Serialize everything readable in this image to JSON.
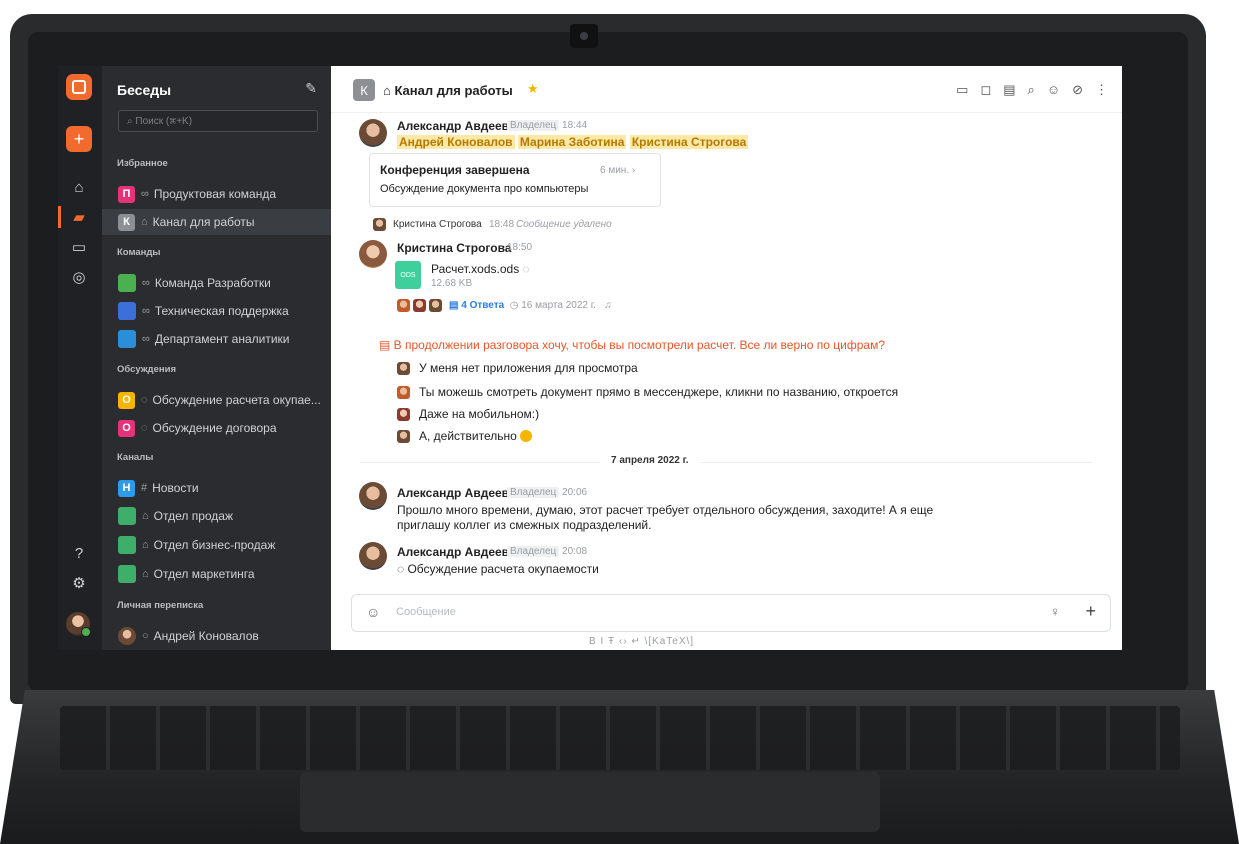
{
  "sidebar": {
    "title": "Беседы",
    "search_placeholder": "Поиск (⌘+K)",
    "sections": {
      "favorites": "Избранное",
      "teams": "Команды",
      "discussions": "Обсуждения",
      "channels": "Каналы",
      "personal": "Личная переписка"
    },
    "items": [
      {
        "letter": "П",
        "label": "Продуктовая команда",
        "color": "#e5337a"
      },
      {
        "letter": "К",
        "label": "Канал для работы",
        "color": "#8c8f94"
      },
      {
        "label": "Команда Разработки"
      },
      {
        "label": "Техническая поддержка"
      },
      {
        "label": "Департамент аналитики"
      },
      {
        "letter": "О",
        "label": "Обсуждение расчета окупае...",
        "color": "#f5b400"
      },
      {
        "letter": "О",
        "label": "Обсуждение договора",
        "color": "#e5337a"
      },
      {
        "letter": "Н",
        "label": "Новости",
        "color": "#2f9be8"
      },
      {
        "label": "Отдел продаж"
      },
      {
        "label": "Отдел бизнес-продаж"
      },
      {
        "label": "Отдел маркетинга"
      },
      {
        "label": "Андрей Коновалов"
      }
    ]
  },
  "channel": {
    "letter": "К",
    "title": "Канал для работы"
  },
  "messages": {
    "m1": {
      "author": "Александр Авдеев",
      "role": "Владелец",
      "time": "18:44",
      "mentions": [
        "Андрей Коновалов",
        "Марина Заботина",
        "Кристина Строгова"
      ],
      "card_title": "Конференция завершена",
      "card_time": "6 мин. ›",
      "card_text": "Обсуждение документа про компьютеры"
    },
    "m2": {
      "author": "Кристина Строгова",
      "time": "18:48",
      "text": "Сообщение удалено"
    },
    "m3": {
      "author": "Кристина Строгова",
      "time": "18:50",
      "file_type": "ODS",
      "file_name": "Расчет.xods.ods",
      "file_size": "12.68 KB",
      "replies": "4 Ответа",
      "reply_date": "16 марта 2022 г."
    },
    "thread": {
      "question": "В продолжении разговора хочу, чтобы вы посмотрели расчет. Все ли верно по цифрам?",
      "replies": [
        "У меня нет приложения для просмотра",
        "Ты можешь смотреть документ прямо в мессенджере, кликни по названию, откроется",
        "Даже на мобильном:)",
        "А, действительно"
      ]
    },
    "date_divider": "7 апреля 2022 г.",
    "m4": {
      "author": "Александр Авдеев",
      "role": "Владелец",
      "time": "20:06",
      "line1": "Прошло много времени, думаю, этот расчет требует отдельного обсуждения, заходите! А я еще",
      "line2": "приглашу коллег из смежных подразделений."
    },
    "m5": {
      "author": "Александр Авдеев",
      "role": "Владелец",
      "time": "20:08",
      "text": "Обсуждение расчета окупаемости"
    }
  },
  "composer": {
    "placeholder": "Сообщение",
    "format_bar": "B  I  Ŧ  ‹›  ↵  \\[KaTeX\\]"
  }
}
